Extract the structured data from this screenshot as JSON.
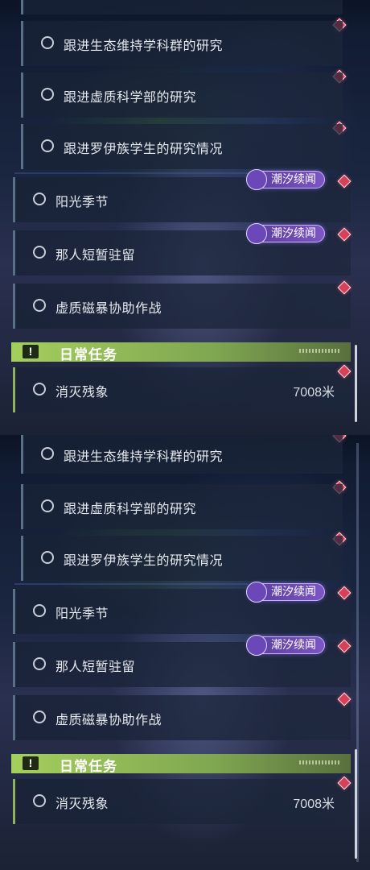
{
  "colors": {
    "accent_green": "#a5cf5d",
    "marker_red": "#d8405a",
    "tide_purple": "#7c56c4",
    "row_border": "#5a7088"
  },
  "panels": [
    {
      "quests": [
        {
          "label": "跟进生态维持学科群的研究"
        },
        {
          "label": "跟进虚质科学部的研究"
        },
        {
          "label": "跟进罗伊族学生的研究情况"
        },
        {
          "label": "阳光季节",
          "badge": "潮汐续闻"
        },
        {
          "label": "那人短暂驻留",
          "badge": "潮汐续闻"
        },
        {
          "label": "虚质磁暴协助作战"
        }
      ],
      "section": {
        "title": "日常任务",
        "icon": "exclamation-icon"
      },
      "daily": {
        "label": "消灭残象",
        "distance": "7008米"
      }
    },
    {
      "quests": [
        {
          "label": "跟进生态维持学科群的研究"
        },
        {
          "label": "跟进虚质科学部的研究"
        },
        {
          "label": "跟进罗伊族学生的研究情况"
        },
        {
          "label": "阳光季节",
          "badge": "潮汐续闻"
        },
        {
          "label": "那人短暂驻留",
          "badge": "潮汐续闻"
        },
        {
          "label": "虚质磁暴协助作战"
        }
      ],
      "section": {
        "title": "日常任务",
        "icon": "exclamation-icon"
      },
      "daily": {
        "label": "消灭残象",
        "distance": "7008米"
      }
    }
  ]
}
